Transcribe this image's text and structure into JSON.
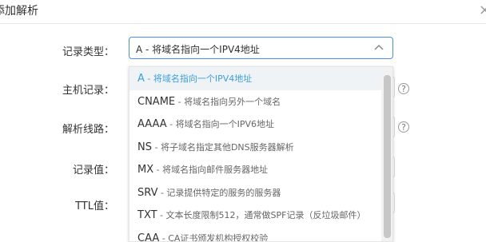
{
  "dialog": {
    "title": "添加解析"
  },
  "form": {
    "record_type_label": "记录类型：",
    "host_label": "主机记录：",
    "line_label": "解析线路：",
    "value_label": "记录值：",
    "ttl_label": "TTL值：",
    "selected_value": "A - 将域名指向一个IPV4地址"
  },
  "dropdown": {
    "options": [
      {
        "code": "A",
        "desc": " - 将域名指向一个IPV4地址",
        "selected": true
      },
      {
        "code": "CNAME",
        "desc": " - 将域名指向另外一个域名",
        "selected": false
      },
      {
        "code": "AAAA",
        "desc": " - 将域名指向一个IPV6地址",
        "selected": false
      },
      {
        "code": "NS",
        "desc": " - 将子域名指定其他DNS服务器解析",
        "selected": false
      },
      {
        "code": "MX",
        "desc": " - 将域名指向邮件服务器地址",
        "selected": false
      },
      {
        "code": "SRV",
        "desc": " - 记录提供特定的服务的服务器",
        "selected": false
      },
      {
        "code": "TXT",
        "desc": " - 文本长度限制512，通常做SPF记录（反垃圾邮件）",
        "selected": false
      },
      {
        "code": "CAA",
        "desc": " - CA证书颁发机构授权校验",
        "selected": false
      }
    ]
  },
  "colors": {
    "accent": "#3a9fdc",
    "border_focus": "#4a90e2"
  }
}
